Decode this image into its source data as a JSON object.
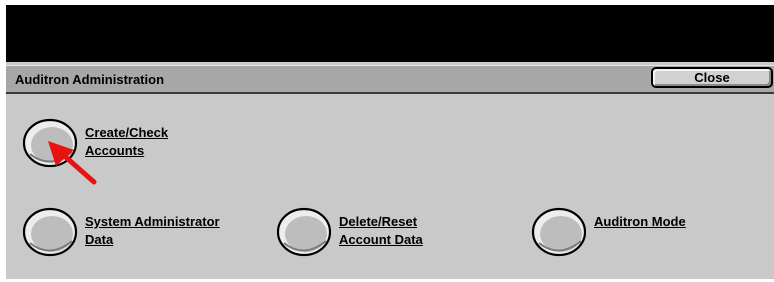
{
  "window": {
    "title": "Auditron Administration",
    "close_label": "Close"
  },
  "options": {
    "create_check": {
      "line1": "Create/Check",
      "line2": "Accounts"
    },
    "system_admin": {
      "line1": "System Administrator",
      "line2": "Data"
    },
    "delete_reset": {
      "line1": "Delete/Reset",
      "line2": "Account Data"
    },
    "auditron_mode": {
      "line1": "Auditron Mode",
      "line2": ""
    }
  },
  "colors": {
    "panel": "#c9c9c9",
    "titlebar": "#a7a7a7",
    "topbar": "#000000",
    "pointer_arrow": "#e81212"
  },
  "icons": {
    "pointer": "red-arrow-icon",
    "option_button": "round-button"
  }
}
